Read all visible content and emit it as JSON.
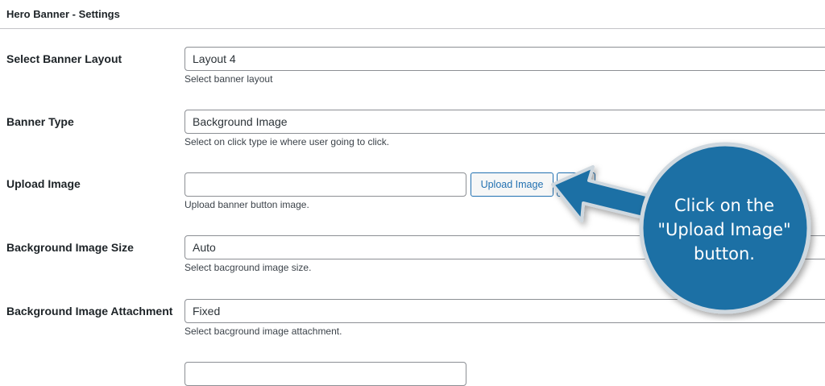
{
  "panel": {
    "title": "Hero Banner - Settings"
  },
  "fields": {
    "banner_layout": {
      "label": "Select Banner Layout",
      "value": "Layout 4",
      "description": "Select banner layout"
    },
    "banner_type": {
      "label": "Banner Type",
      "value": "Background Image",
      "description": "Select on click type ie where user going to click."
    },
    "upload_image": {
      "label": "Upload Image",
      "value": "",
      "button_label": "Upload Image",
      "description": "Upload banner button image."
    },
    "background_image_size": {
      "label": "Background Image Size",
      "value": "Auto",
      "description": "Select bacground image size."
    },
    "background_image_attachment": {
      "label": "Background Image Attachment",
      "value": "Fixed",
      "description": "Select bacground image attachment."
    }
  },
  "callout": {
    "line1": "Click on the",
    "line2": "\"Upload Image\"",
    "line3": "button.",
    "color": "#1d6fa5",
    "border_color": "#cfd8df"
  },
  "colors": {
    "button_accent": "#2271b1",
    "input_border": "#8c8f94",
    "divider": "#c3c4c7"
  }
}
